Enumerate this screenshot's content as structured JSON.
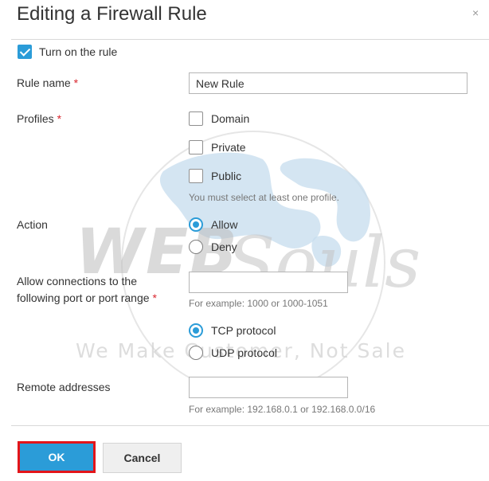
{
  "dialog": {
    "title": "Editing a Firewall Rule",
    "close_glyph": "×"
  },
  "turn_on": {
    "label": "Turn on the rule",
    "checked": true
  },
  "rule_name": {
    "label": "Rule name",
    "required_mark": "*",
    "value": "New Rule"
  },
  "profiles": {
    "label": "Profiles",
    "required_mark": "*",
    "options": [
      {
        "label": "Domain",
        "checked": false
      },
      {
        "label": "Private",
        "checked": false
      },
      {
        "label": "Public",
        "checked": false
      }
    ],
    "hint": "You must select at least one profile."
  },
  "action": {
    "label": "Action",
    "options": [
      {
        "label": "Allow",
        "selected": true
      },
      {
        "label": "Deny",
        "selected": false
      }
    ]
  },
  "ports": {
    "label_line1": "Allow connections to the",
    "label_line2": "following port or port range",
    "required_mark": "*",
    "value": "",
    "hint": "For example: 1000 or 1000-1051",
    "protocols": [
      {
        "label": "TCP protocol",
        "selected": true
      },
      {
        "label": "UDP protocol",
        "selected": false
      }
    ]
  },
  "remote": {
    "label": "Remote addresses",
    "value": "",
    "hint": "For example: 192.168.0.1 or 192.168.0.0/16"
  },
  "buttons": {
    "ok": "OK",
    "cancel": "Cancel"
  },
  "watermark": {
    "brand_left": "WEB",
    "brand_right": "Souls",
    "tagline": "We Make Customer, Not Sale"
  },
  "colors": {
    "accent": "#2b9cd8",
    "required": "#d9262e",
    "highlight_border": "#e3151a"
  }
}
